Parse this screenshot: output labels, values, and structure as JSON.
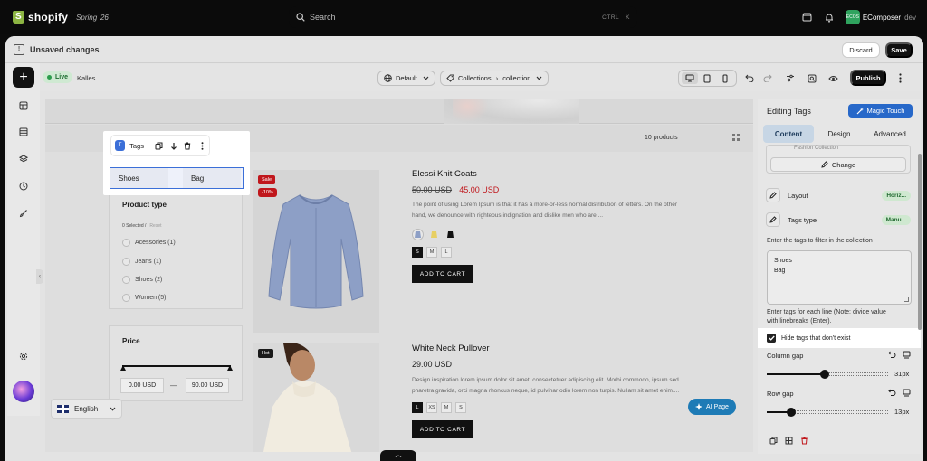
{
  "topbar": {
    "brand": "shopify",
    "season": "Spring '26",
    "search_placeholder": "Search",
    "shortcut_ctrl": "CTRL",
    "shortcut_key": "K",
    "store_initials": "ECOS",
    "store_name": "EComposer",
    "store_role": "dev"
  },
  "unsaved_bar": {
    "title": "Unsaved changes",
    "discard_label": "Discard",
    "save_label": "Save"
  },
  "editor_bar": {
    "status": "Live",
    "theme": "Kalles",
    "language_select": "Default",
    "breadcrumb_parent": "Collections",
    "breadcrumb_child": "collection",
    "publish_label": "Publish"
  },
  "canvas": {
    "product_count": "10 products",
    "tags_widget": {
      "name": "Tags",
      "tags": [
        "Shoes",
        "Bag"
      ]
    },
    "filters": {
      "product_type": {
        "title": "Product type",
        "selected": "0 Selected",
        "separator": "/",
        "reset": "Reset",
        "items": [
          "Acessories (1)",
          "Jeans (1)",
          "Shoes (2)",
          "Women (5)"
        ]
      },
      "price": {
        "title": "Price",
        "min": "0.00 USD",
        "dash": "—",
        "max": "90.00 USD"
      }
    },
    "products": [
      {
        "name": "Elessi Knit Coats",
        "old_price": "50.00 USD",
        "price": "45.00 USD",
        "badges": [
          "Sale",
          "-10%"
        ],
        "description": "The point of using Lorem Ipsum is that it has a more-or-less normal distribution of letters. On the other hand, we denounce with righteous indignation and dislike men who are....",
        "sizes": [
          "S",
          "M",
          "L"
        ],
        "selected_size": "S",
        "cart_label": "ADD TO CART"
      },
      {
        "name": "White Neck Pullover",
        "price": "29.00 USD",
        "badges": [
          "Hot"
        ],
        "description": "Design inspiration lorem ipsum dolor sit amet, consectetuer adipiscing elit. Morbi commodo, ipsum sed pharetra gravida, orci magna rhoncus neque, id pulvinar odio lorem non turpis. Nullam sit amet enim....",
        "sizes": [
          "L",
          "XS",
          "M",
          "S"
        ],
        "selected_size": "L",
        "cart_label": "ADD TO CART"
      }
    ],
    "language": "English",
    "ai_label": "AI Page"
  },
  "right_panel": {
    "title": "Editing Tags",
    "magic_label": "Magic Touch",
    "tabs": [
      "Content",
      "Design",
      "Advanced"
    ],
    "active_tab": "Content",
    "ghost_text": "Fashion Collection",
    "change_label": "Change",
    "layout": {
      "label": "Layout",
      "value": "Horiz..."
    },
    "tags_type": {
      "label": "Tags type",
      "value": "Manu..."
    },
    "tags_instruction": "Enter the tags to filter in the collection",
    "tags_value_lines": [
      "Shoes",
      "Bag"
    ],
    "tags_note_line1": "Enter tags for each line (Note: divide value",
    "tags_note_line2": "with linebreaks (Enter).",
    "hide_tags_label": "Hide tags that don't exist",
    "hide_tags_checked": true,
    "column_gap": {
      "label": "Column gap",
      "value": "31px",
      "fraction": 0.48
    },
    "row_gap": {
      "label": "Row gap",
      "value": "13px",
      "fraction": 0.2
    }
  },
  "colors": {
    "accent_blue": "#2768c9",
    "sale_red": "#c0171c",
    "live_green": "#2c9c4c"
  }
}
